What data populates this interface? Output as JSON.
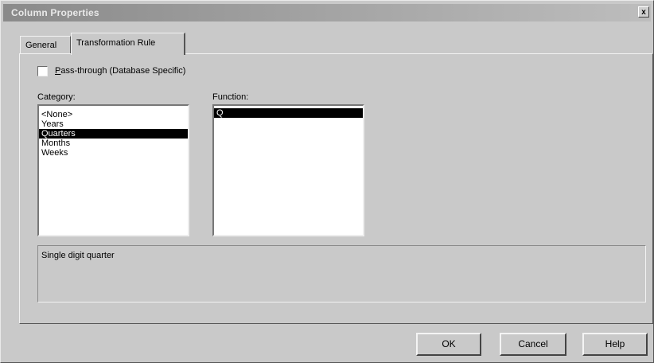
{
  "window": {
    "title": "Column Properties",
    "close_label": "x"
  },
  "tabs": [
    {
      "label": "General",
      "active": false
    },
    {
      "label": "Transformation Rule",
      "active": true
    }
  ],
  "passthrough": {
    "label_prefix": "",
    "label_underlined": "P",
    "label_rest": "ass-through (Database Specific)",
    "checked": false
  },
  "category": {
    "label": "Category:",
    "items": [
      "<None>",
      "Years",
      "Quarters",
      "Months",
      "Weeks"
    ],
    "selected_index": 2
  },
  "function": {
    "label": "Function:",
    "items": [
      "Q"
    ],
    "selected_index": 0
  },
  "description": {
    "text": "Single digit quarter"
  },
  "buttons": {
    "ok": "OK",
    "cancel": "Cancel",
    "help": "Help"
  }
}
